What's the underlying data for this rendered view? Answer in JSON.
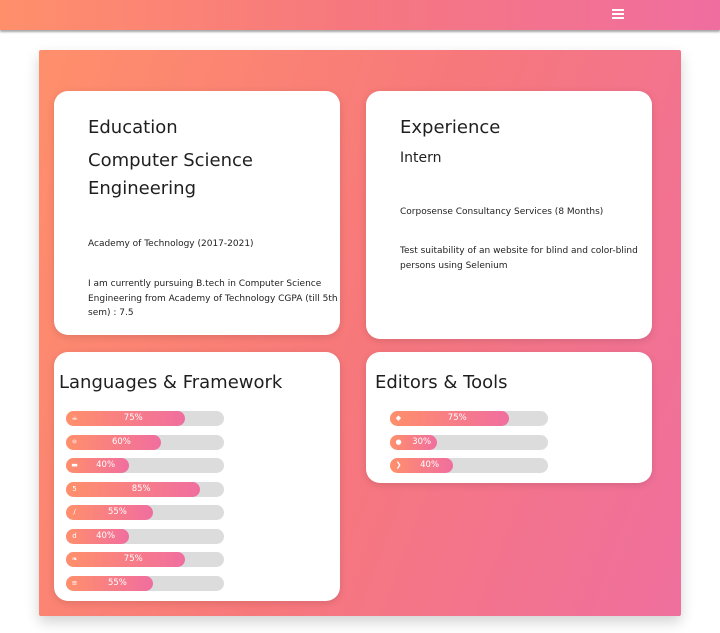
{
  "navbar": {
    "menu_icon": "hamburger-menu-icon"
  },
  "education": {
    "heading": "Education",
    "degree_line1": "Computer Science",
    "degree_line2": "Engineering",
    "institution": "Academy of Technology (2017-2021)",
    "desc_line1": "I am currently pursuing B.tech in Computer Science",
    "desc_line2": "Engineering from Academy of Technology CGPA (till 5th",
    "desc_line3": "sem) : 7.5"
  },
  "experience": {
    "heading": "Experience",
    "role": "Intern",
    "company": "Corposense Consultancy Services (8 Months)",
    "desc_line1": "Test suitability of an website for blind and color-blind",
    "desc_line2": "persons using Selenium"
  },
  "languages": {
    "heading": "Languages & Framework",
    "skills": [
      {
        "icon": "java-icon",
        "label": "75%",
        "value": 0.75
      },
      {
        "icon": "react-icon",
        "label": "60%",
        "value": 0.6
      },
      {
        "icon": "js-icon",
        "label": "40%",
        "value": 0.4
      },
      {
        "icon": "html5-icon",
        "label": "85%",
        "value": 0.85
      },
      {
        "icon": "css-icon",
        "label": "55%",
        "value": 0.55
      },
      {
        "icon": "django-icon",
        "label": "40%",
        "value": 0.4
      },
      {
        "icon": "python-icon",
        "label": "75%",
        "value": 0.75
      },
      {
        "icon": "database-icon",
        "label": "55%",
        "value": 0.55
      }
    ]
  },
  "tools": {
    "heading": "Editors & Tools",
    "skills": [
      {
        "icon": "git-icon",
        "label": "75%",
        "value": 0.75
      },
      {
        "icon": "microphone-icon",
        "label": "30%",
        "value": 0.3
      },
      {
        "icon": "vscode-icon",
        "label": "40%",
        "value": 0.4
      }
    ]
  }
}
